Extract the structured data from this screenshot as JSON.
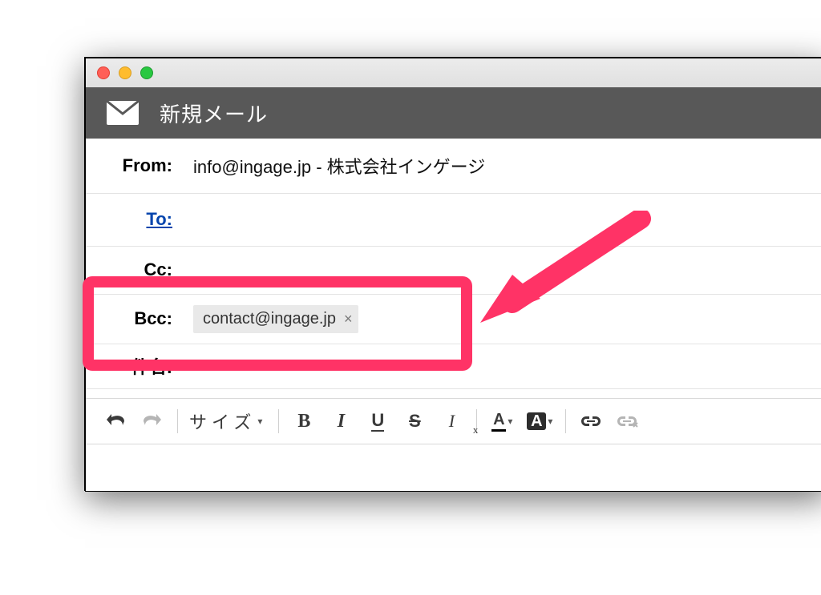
{
  "window": {
    "title": "新規メール"
  },
  "fields": {
    "from_label": "From:",
    "from_email": "info@ingage.jp",
    "from_sep": " - ",
    "from_name": "株式会社インゲージ",
    "to_label": "To:",
    "cc_label": "Cc:",
    "bcc_label": "Bcc:",
    "bcc_chip": "contact@ingage.jp",
    "bcc_chip_x": "×",
    "subject_label": "件名:"
  },
  "toolbar": {
    "size_label": "サイズ",
    "bold": "B",
    "italic": "I",
    "underline": "U",
    "strike": "S",
    "clearfmt": "I",
    "clearfmt_x": "x",
    "textcolor": "A",
    "highlight": "A"
  },
  "annotation": {
    "highlight_color": "#ff3366"
  }
}
